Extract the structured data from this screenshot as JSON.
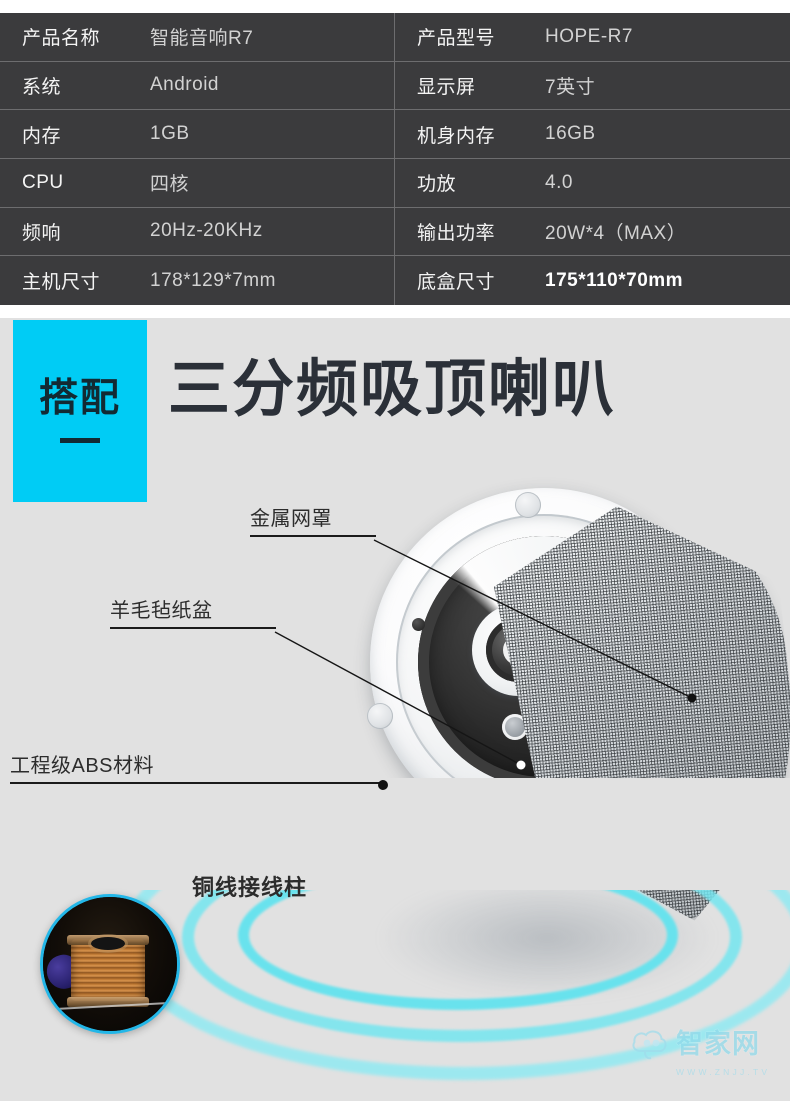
{
  "spec_table": {
    "rows": [
      {
        "label_left": "产品名称",
        "value_left": "智能音响R7",
        "label_right": "产品型号",
        "value_right": "HOPE-R7"
      },
      {
        "label_left": "系统",
        "value_left": "Android",
        "label_right": "显示屏",
        "value_right": "7英寸"
      },
      {
        "label_left": "内存",
        "value_left": "1GB",
        "label_right": "机身内存",
        "value_right": "16GB"
      },
      {
        "label_left": "CPU",
        "value_left": "四核",
        "label_right": "功放",
        "value_right": "4.0"
      },
      {
        "label_left": "频响",
        "value_left": "20Hz-20KHz",
        "label_right": "输出功率",
        "value_right": "20W*4（MAX）"
      },
      {
        "label_left": "主机尺寸",
        "value_left": "178*129*7mm",
        "label_right": "底盒尺寸",
        "value_right": "175*110*70mm"
      }
    ]
  },
  "section": {
    "badge_label": "搭配",
    "title": "三分频吸顶喇叭"
  },
  "callouts": [
    {
      "name": "metal-mesh-cover",
      "label": "金属网罩"
    },
    {
      "name": "wool-felt-cone",
      "label": "羊毛毡纸盆"
    },
    {
      "name": "abs-material",
      "label": "工程级ABS材料"
    }
  ],
  "wire_inset": {
    "label": "铜线接线柱"
  },
  "watermark": {
    "brand": "智家网",
    "url": "WWW.ZNJJ.TV",
    "icon": "cloud-icon"
  },
  "colors": {
    "table_bg": "#3b3b3d",
    "panel_bg": "#e1e1e1",
    "accent_cyan": "#00ccf5",
    "wave_cyan": "#74e6f0",
    "title_dark": "#2b3038"
  }
}
